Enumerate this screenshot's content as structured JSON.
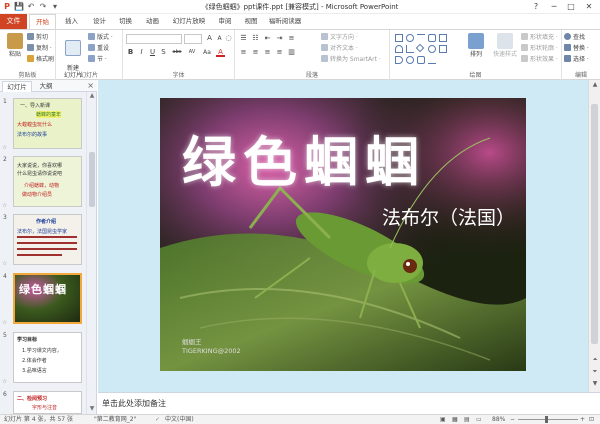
{
  "window": {
    "title": "《绿色蝈蝈》ppt课件.ppt [兼容模式] - Microsoft PowerPoint",
    "help": "?",
    "minimize": "─",
    "maximize": "□",
    "close": "✕"
  },
  "quick_access": {
    "app_icon": "P",
    "save": "💾",
    "undo": "↶",
    "redo": "↷",
    "more": "▾"
  },
  "ribbon_tabs": {
    "file": "文件",
    "items": [
      "开始",
      "插入",
      "设计",
      "切换",
      "动画",
      "幻灯片放映",
      "审阅",
      "视图",
      "福昕阅读器"
    ],
    "active_index": 0
  },
  "ribbon": {
    "clipboard": {
      "label": "剪贴板",
      "paste": "粘贴",
      "cut": "剪切",
      "copy": "复制 ·",
      "format_painter": "格式刷"
    },
    "slides": {
      "label": "幻灯片",
      "new_slide": "新建\n幻灯片",
      "layout": "版式 ·",
      "reset": "重设",
      "section": "节 ·"
    },
    "font": {
      "label": "字体",
      "bold": "B",
      "italic": "I",
      "underline": "U",
      "strike": "S",
      "abc": "abc",
      "spacing": "AV",
      "case": "Aa",
      "color": "A"
    },
    "paragraph": {
      "label": "段落",
      "text_direction": "文字方向 ·",
      "align_text": "对齐文本 ·",
      "smartart": "转换为 SmartArt ·"
    },
    "drawing": {
      "label": "绘图",
      "arrange": "排列",
      "quick_styles": "快速样式",
      "shape_fill": "形状填充 ·",
      "shape_outline": "形状轮廓 ·",
      "shape_effects": "形状效果 ·"
    },
    "editing": {
      "label": "编辑",
      "find": "查找",
      "replace": "替换 ·",
      "select": "选择 ·"
    }
  },
  "slides_pane": {
    "tab_slides": "幻灯片",
    "tab_outline": "大纲",
    "close": "×",
    "thumbs": [
      {
        "number": "1",
        "lines": [
          "一、导入新课",
          "蟋蟀的童年",
          "大蝗蝗虫玩什么",
          "法布尔的故事"
        ]
      },
      {
        "number": "2",
        "lines": [
          "大家说说，你喜欢哪",
          "什么昆虫请你说说吧",
          "介绍蟋蟀，动物",
          "做动物介绍员"
        ]
      },
      {
        "number": "3",
        "lines": [
          "作者介绍",
          "法布尔，法国昆虫学家"
        ]
      },
      {
        "number": "4",
        "lines": [
          "绿色蝈蝈"
        ]
      },
      {
        "number": "5",
        "lines": [
          "学习目标",
          "1.学习课文内容，",
          "2.体会作者",
          "3.品味语言"
        ]
      },
      {
        "number": "6",
        "lines": [
          "二、检阅预习",
          "字形与注音"
        ]
      }
    ],
    "selected_index": 3
  },
  "slide": {
    "title": "绿色蝈蝈",
    "subtitle": "法布尔（法国）",
    "credit_line1": "蝈蝈王",
    "credit_line2": "TIGERKING@2002"
  },
  "notes": {
    "placeholder": "单击此处添加备注"
  },
  "status": {
    "slide_info": "幻灯片 第 4 张，共 57 张",
    "theme": "\"第二教育网_2\"",
    "language": "中文(中国)",
    "zoom": "88%"
  },
  "colors": {
    "accent": "#d04423",
    "canvas_bg": "#cfeaf4",
    "selected_thumb": "#f3a83b"
  }
}
